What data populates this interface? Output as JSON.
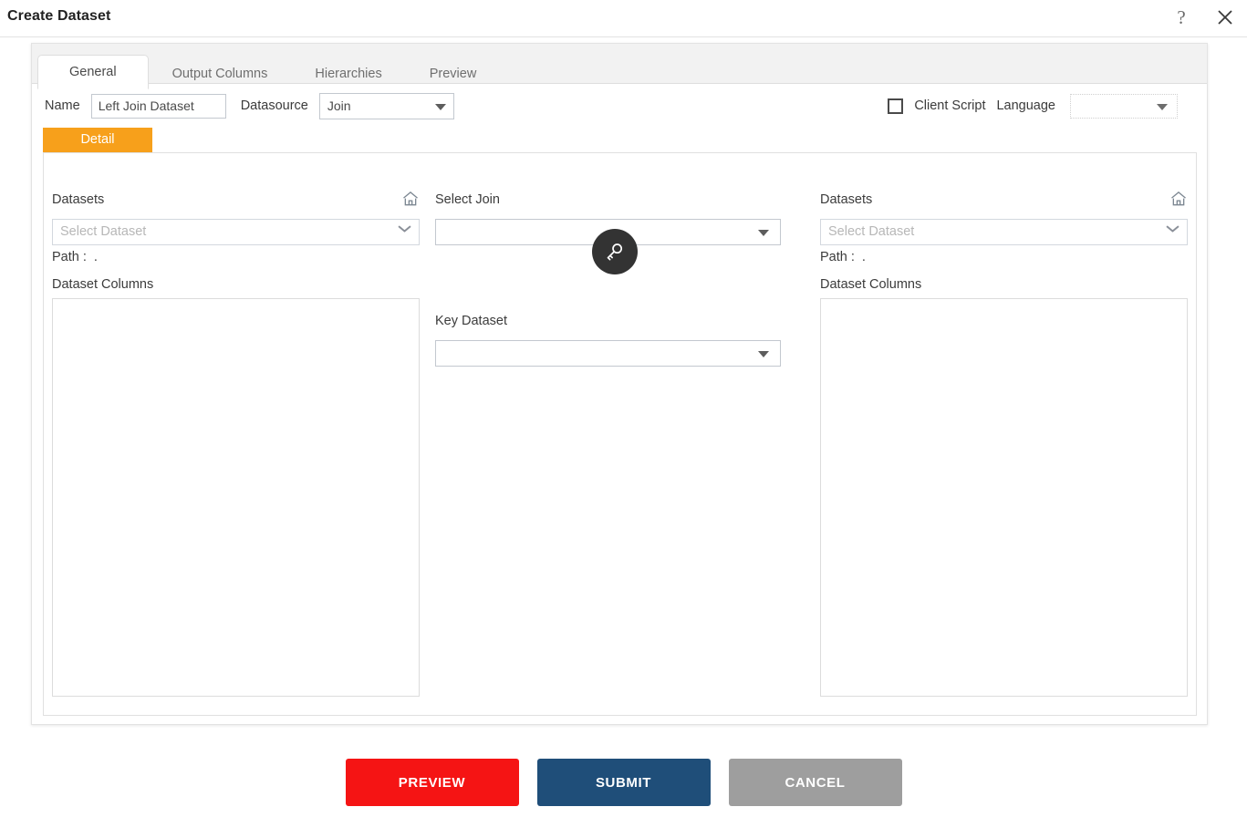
{
  "window": {
    "title": "Create Dataset",
    "help_icon": "question-mark-icon",
    "close_icon": "close-icon"
  },
  "tabs": [
    {
      "label": "General",
      "active": true
    },
    {
      "label": "Output Columns",
      "active": false
    },
    {
      "label": "Hierarchies",
      "active": false
    },
    {
      "label": "Preview",
      "active": false
    }
  ],
  "form": {
    "name_label": "Name",
    "name_value": "Left Join Dataset",
    "datasource_label": "Datasource",
    "datasource_value": "Join",
    "client_script_label": "Client Script",
    "client_script_checked": false,
    "language_label": "Language",
    "language_value": ""
  },
  "detail_tab": {
    "label": "Detail"
  },
  "left_panel": {
    "datasets_label": "Datasets",
    "home_icon": "home-icon",
    "dataset_placeholder": "Select Dataset",
    "dataset_value": "",
    "path_label": "Path :",
    "path_value": ".",
    "columns_label": "Dataset Columns",
    "columns": []
  },
  "middle_panel": {
    "select_join_label": "Select Join",
    "select_join_value": "",
    "key_icon": "key-icon",
    "key_dataset_label": "Key Dataset",
    "key_dataset_value": ""
  },
  "right_panel": {
    "datasets_label": "Datasets",
    "home_icon": "home-icon",
    "dataset_placeholder": "Select Dataset",
    "dataset_value": "",
    "path_label": "Path :",
    "path_value": ".",
    "columns_label": "Dataset Columns",
    "columns": []
  },
  "footer": {
    "preview_label": "PREVIEW",
    "submit_label": "SUBMIT",
    "cancel_label": "CANCEL"
  },
  "colors": {
    "accent_orange": "#f7a01b",
    "preview_red": "#f51414",
    "submit_blue": "#1f4e79",
    "cancel_gray": "#9e9e9e",
    "key_circle": "#333333"
  }
}
